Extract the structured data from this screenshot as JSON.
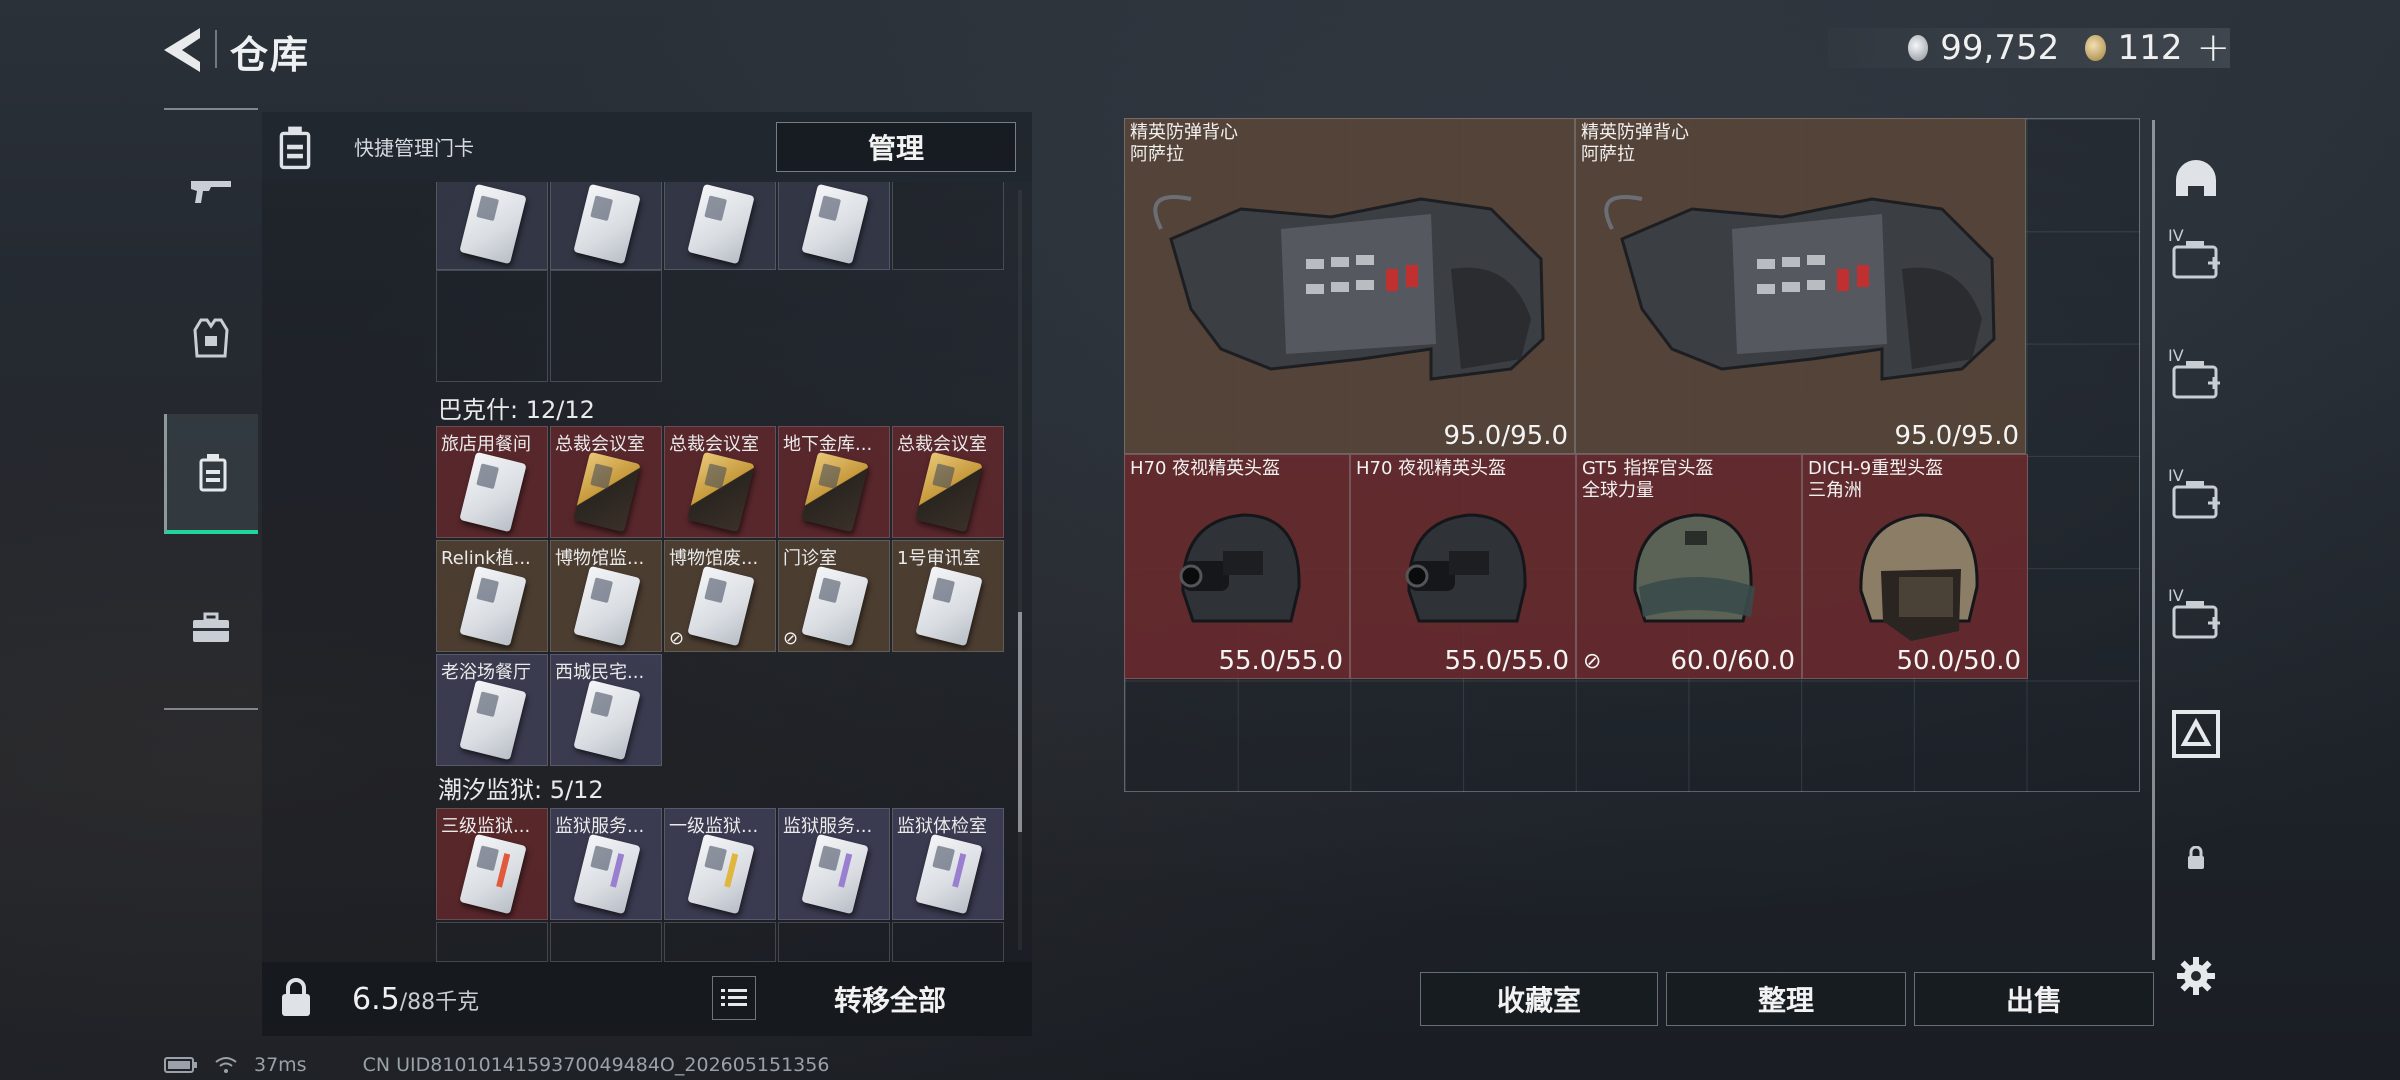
{
  "header": {
    "title": "仓库",
    "currency_silver": "99,752",
    "currency_gold": "112",
    "currency_plus": "+"
  },
  "panel": {
    "quick_manage_label": "快捷管理门卡",
    "manage_button": "管理",
    "groups": [
      {
        "label": "巴克什: 12/12"
      },
      {
        "label": "潮汐监狱: 5/12"
      }
    ],
    "top_cards": [
      "",
      "",
      "",
      ""
    ],
    "bakesh_cards": [
      {
        "name": "旅店用餐间",
        "color": "red",
        "card": "silver"
      },
      {
        "name": "总裁会议室",
        "color": "red",
        "card": "gold"
      },
      {
        "name": "总裁会议室",
        "color": "red",
        "card": "gold"
      },
      {
        "name": "地下金库...",
        "color": "red",
        "card": "gold"
      },
      {
        "name": "总裁会议室",
        "color": "red",
        "card": "gold"
      },
      {
        "name": "Relink植...",
        "color": "brown",
        "card": "silver"
      },
      {
        "name": "博物馆监...",
        "color": "brown",
        "card": "silver"
      },
      {
        "name": "博物馆废...",
        "color": "brown",
        "card": "silver",
        "ban": true
      },
      {
        "name": "门诊室",
        "color": "brown",
        "card": "silver",
        "ban": true
      },
      {
        "name": "1号审讯室",
        "color": "brown",
        "card": "silver"
      },
      {
        "name": "老浴场餐厅",
        "color": "violet",
        "card": "silver"
      },
      {
        "name": "西城民宅...",
        "color": "violet",
        "card": "silver"
      }
    ],
    "prison_cards": [
      {
        "name": "三级监狱...",
        "color": "red",
        "stripe": "#e05a3c"
      },
      {
        "name": "监狱服务...",
        "color": "violet",
        "stripe": "#9a7fd0"
      },
      {
        "name": "一级监狱...",
        "color": "violet",
        "stripe": "#e0b63c"
      },
      {
        "name": "监狱服务...",
        "color": "violet",
        "stripe": "#9a7fd0"
      },
      {
        "name": "监狱体检室",
        "color": "violet",
        "stripe": "#9a7fd0"
      }
    ],
    "ban_icon": "⊘",
    "weight_value": "6.5",
    "weight_capacity": "/88千克",
    "transfer_all": "转移全部"
  },
  "items": [
    {
      "name": "精英防弹背心",
      "sub": "阿萨拉",
      "durability": "95.0/95.0",
      "type": "vest"
    },
    {
      "name": "精英防弹背心",
      "sub": "阿萨拉",
      "durability": "95.0/95.0",
      "type": "vest"
    },
    {
      "name": "H70 夜视精英头盔",
      "sub": "",
      "durability": "55.0/55.0",
      "type": "helmet-nv"
    },
    {
      "name": "H70 夜视精英头盔",
      "sub": "",
      "durability": "55.0/55.0",
      "type": "helmet-nv"
    },
    {
      "name": "GT5 指挥官头盔",
      "sub": "全球力量",
      "durability": "60.0/60.0",
      "type": "helmet-gt5",
      "ban": true
    },
    {
      "name": "DICH-9重型头盔",
      "sub": "三角洲",
      "durability": "50.0/50.0",
      "type": "helmet-dich"
    }
  ],
  "right_icons": [
    {
      "name": "helmet-slot-icon",
      "tag": ""
    },
    {
      "name": "case-add-icon-1",
      "tag": "IV"
    },
    {
      "name": "cash-case-icon",
      "tag": "IV"
    },
    {
      "name": "doc-case-icon",
      "tag": "IV"
    },
    {
      "name": "case-add-icon-2",
      "tag": "IV"
    },
    {
      "name": "pass-case-icon",
      "tag": ""
    },
    {
      "name": "lock-icon",
      "tag": ""
    }
  ],
  "bottom_buttons": {
    "collection": "收藏室",
    "organize": "整理",
    "sell": "出售"
  },
  "status": {
    "ping": "37ms",
    "uid": "CN UID8101014159370049484O_202605151356"
  }
}
